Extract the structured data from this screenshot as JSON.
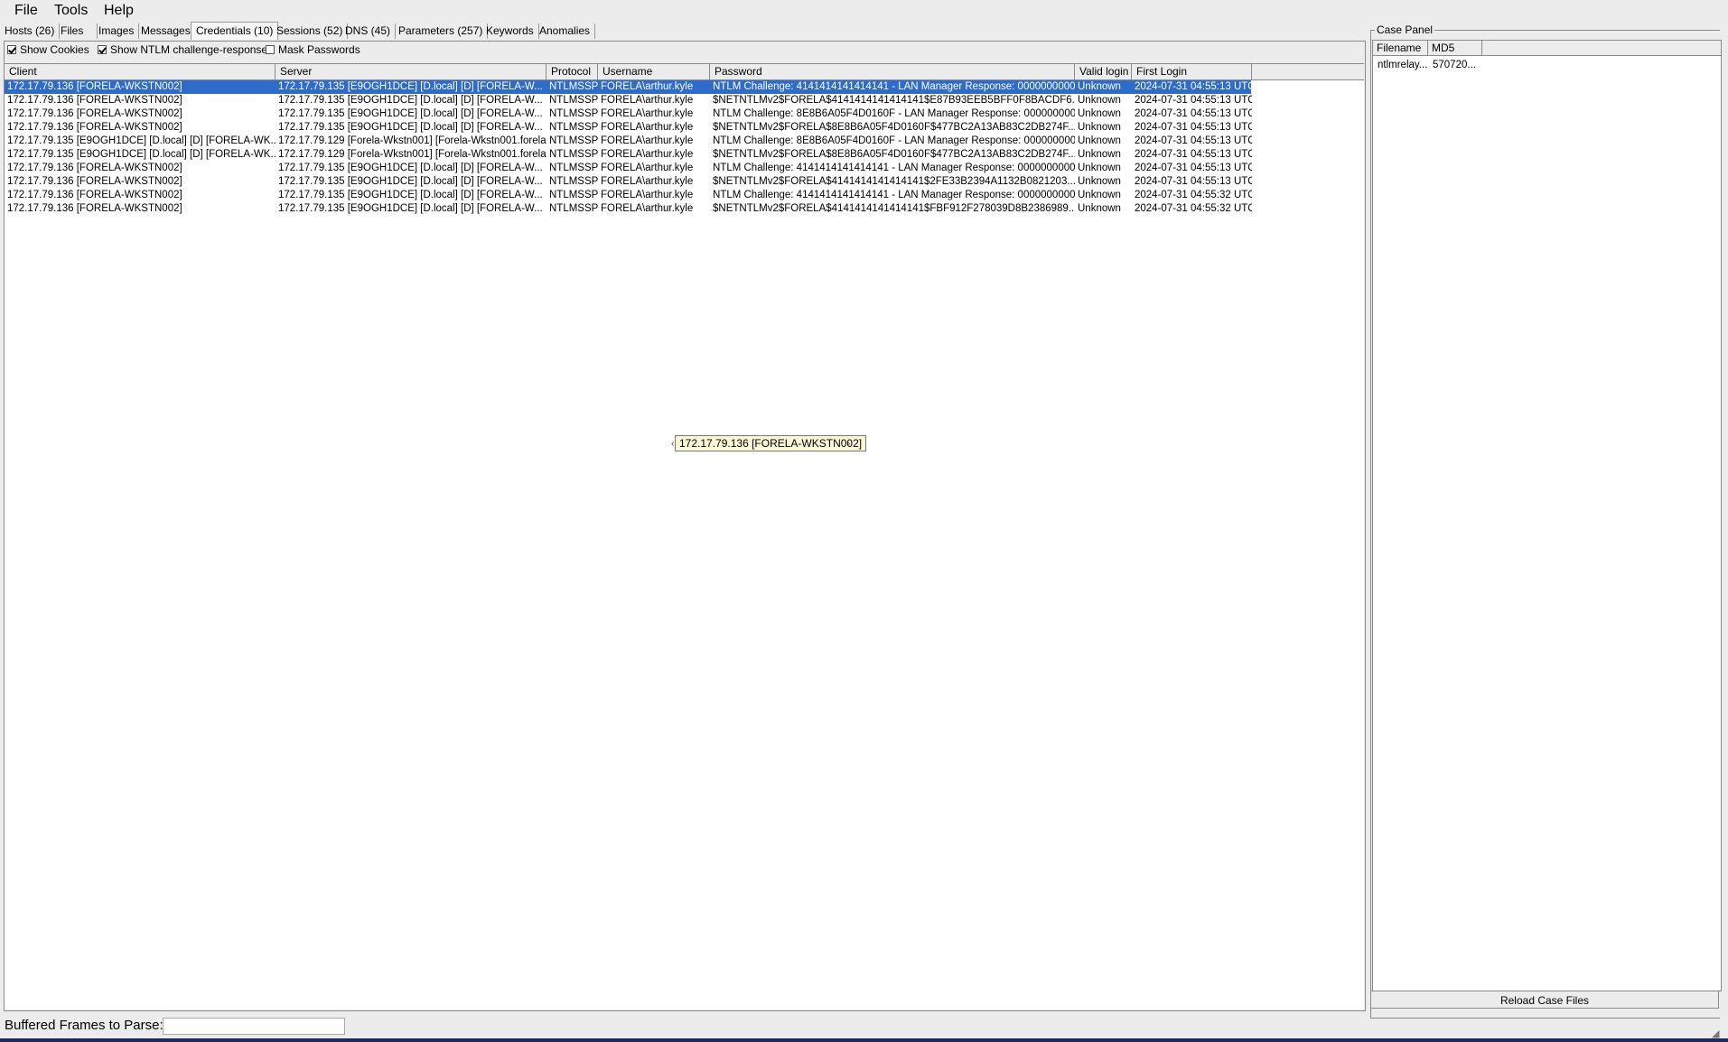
{
  "menu": {
    "file": "File",
    "tools": "Tools",
    "help": "Help"
  },
  "tabs": [
    "Hosts (26)",
    "Files",
    "Images",
    "Messages",
    "Credentials (10)",
    "Sessions (52)",
    "DNS (45)",
    "Parameters (257)",
    "Keywords",
    "Anomalies"
  ],
  "filters": {
    "show_cookies": "Show Cookies",
    "show_ntlm": "Show NTLM challenge-response",
    "mask_passwords": "Mask Passwords"
  },
  "columns": [
    "Client",
    "Server",
    "Protocol",
    "Username",
    "Password",
    "Valid login",
    "First Login"
  ],
  "rows": [
    [
      "172.17.79.136 [FORELA-WKSTN002]",
      "172.17.79.135 [E9OGH1DCE] [D.local] [D] [FORELA-W...",
      "NTLMSSP",
      "FORELA\\arthur.kyle",
      "NTLM Challenge: 4141414141414141 - LAN Manager Response: 0000000000...",
      "Unknown",
      "2024-07-31 04:55:13 UTC"
    ],
    [
      "172.17.79.136 [FORELA-WKSTN002]",
      "172.17.79.135 [E9OGH1DCE] [D.local] [D] [FORELA-W...",
      "NTLMSSP",
      "FORELA\\arthur.kyle",
      "$NETNTLMv2$FORELA$4141414141414141$E87B93EEB5BFF0F8BACDF6...",
      "Unknown",
      "2024-07-31 04:55:13 UTC"
    ],
    [
      "172.17.79.136 [FORELA-WKSTN002]",
      "172.17.79.135 [E9OGH1DCE] [D.local] [D] [FORELA-W...",
      "NTLMSSP",
      "FORELA\\arthur.kyle",
      "NTLM Challenge: 8E8B6A05F4D0160F - LAN Manager Response: 0000000000...",
      "Unknown",
      "2024-07-31 04:55:13 UTC"
    ],
    [
      "172.17.79.136 [FORELA-WKSTN002]",
      "172.17.79.135 [E9OGH1DCE] [D.local] [D] [FORELA-W...",
      "NTLMSSP",
      "FORELA\\arthur.kyle",
      "$NETNTLMv2$FORELA$8E8B6A05F4D0160F$477BC2A13AB83C2DB274F...",
      "Unknown",
      "2024-07-31 04:55:13 UTC"
    ],
    [
      "172.17.79.135 [E9OGH1DCE] [D.local] [D] [FORELA-WK...",
      "172.17.79.129 [Forela-Wkstn001] [Forela-Wkstn001.forela...",
      "NTLMSSP",
      "FORELA\\arthur.kyle",
      "NTLM Challenge: 8E8B6A05F4D0160F - LAN Manager Response: 0000000000...",
      "Unknown",
      "2024-07-31 04:55:13 UTC"
    ],
    [
      "172.17.79.135 [E9OGH1DCE] [D.local] [D] [FORELA-WK...",
      "172.17.79.129 [Forela-Wkstn001] [Forela-Wkstn001.forela...",
      "NTLMSSP",
      "FORELA\\arthur.kyle",
      "$NETNTLMv2$FORELA$8E8B6A05F4D0160F$477BC2A13AB83C2DB274F...",
      "Unknown",
      "2024-07-31 04:55:13 UTC"
    ],
    [
      "172.17.79.136 [FORELA-WKSTN002]",
      "172.17.79.135 [E9OGH1DCE] [D.local] [D] [FORELA-W...",
      "NTLMSSP",
      "FORELA\\arthur.kyle",
      "NTLM Challenge: 4141414141414141 - LAN Manager Response: 0000000000...",
      "Unknown",
      "2024-07-31 04:55:13 UTC"
    ],
    [
      "172.17.79.136 [FORELA-WKSTN002]",
      "172.17.79.135 [E9OGH1DCE] [D.local] [D] [FORELA-W...",
      "NTLMSSP",
      "FORELA\\arthur.kyle",
      "$NETNTLMv2$FORELA$4141414141414141$2FE33B2394A1132B0821203...",
      "Unknown",
      "2024-07-31 04:55:13 UTC"
    ],
    [
      "172.17.79.136 [FORELA-WKSTN002]",
      "172.17.79.135 [E9OGH1DCE] [D.local] [D] [FORELA-W...",
      "NTLMSSP",
      "FORELA\\arthur.kyle",
      "NTLM Challenge: 4141414141414141 - LAN Manager Response: 0000000000...",
      "Unknown",
      "2024-07-31 04:55:32 UTC"
    ],
    [
      "172.17.79.136 [FORELA-WKSTN002]",
      "172.17.79.135 [E9OGH1DCE] [D.local] [D] [FORELA-W...",
      "NTLMSSP",
      "FORELA\\arthur.kyle",
      "$NETNTLMv2$FORELA$4141414141414141$FBF912F278039D8B2386989...",
      "Unknown",
      "2024-07-31 04:55:32 UTC"
    ]
  ],
  "tooltip": "172.17.79.136 [FORELA-WKSTN002]",
  "case_panel": {
    "title": "Case Panel",
    "columns": [
      "Filename",
      "MD5"
    ],
    "row": [
      "ntlmrelay...",
      "570720..."
    ],
    "reload_button": "Reload Case Files"
  },
  "status": {
    "buffered_label": "Buffered Frames to Parse:"
  },
  "colors": {
    "selection": "#2f6bc9",
    "tooltip_bg": "#fbf7d6"
  }
}
